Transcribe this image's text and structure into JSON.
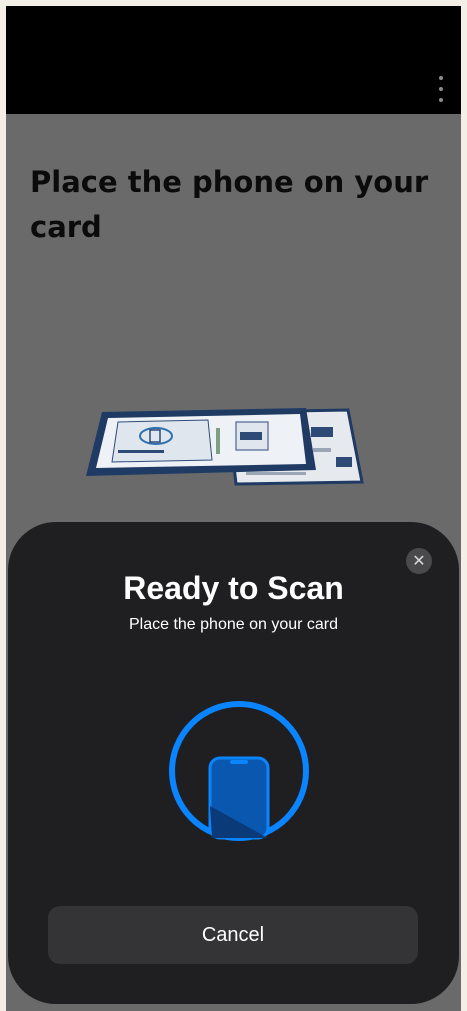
{
  "app": {
    "title": "Place the phone on your card",
    "menu_icon": "more-vertical-icon"
  },
  "nfc_sheet": {
    "title": "Ready to Scan",
    "subtitle": "Place the phone on your card",
    "close_icon": "close-icon",
    "scan_icon": "phone-in-circle-icon",
    "cancel_label": "Cancel"
  },
  "colors": {
    "overlay": "#6a6a6a",
    "topbar": "#000000",
    "sheet": "#1f1f21",
    "accent": "#0a84ff",
    "button": "#343436"
  }
}
